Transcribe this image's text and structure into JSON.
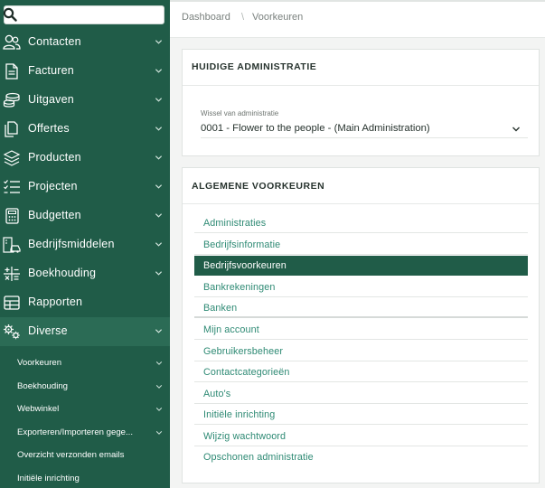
{
  "search": {
    "placeholder": ""
  },
  "sidebar": {
    "items": [
      {
        "label": "Contacten",
        "icon": "contacts-icon"
      },
      {
        "label": "Facturen",
        "icon": "invoice-icon"
      },
      {
        "label": "Uitgaven",
        "icon": "expenses-icon"
      },
      {
        "label": "Offertes",
        "icon": "quotes-icon"
      },
      {
        "label": "Producten",
        "icon": "products-icon"
      },
      {
        "label": "Projecten",
        "icon": "projects-icon"
      },
      {
        "label": "Budgetten",
        "icon": "budget-icon"
      },
      {
        "label": "Bedrijfsmiddelen",
        "icon": "assets-icon"
      },
      {
        "label": "Boekhouding",
        "icon": "accounting-icon"
      },
      {
        "label": "Rapporten",
        "icon": "reports-icon"
      },
      {
        "label": "Diverse",
        "icon": "gears-icon"
      }
    ],
    "subitems": [
      {
        "label": "Voorkeuren"
      },
      {
        "label": "Boekhouding"
      },
      {
        "label": "Webwinkel"
      },
      {
        "label": "Exporteren/Importeren gege..."
      },
      {
        "label": "Overzicht verzonden emails"
      },
      {
        "label": "Initiële inrichting"
      }
    ]
  },
  "breadcrumb": {
    "home": "Dashboard",
    "separator": "\\",
    "current": "Voorkeuren"
  },
  "admin_card": {
    "title": "HUIDIGE ADMINISTRATIE",
    "field_label": "Wissel van administratie",
    "field_value": "0001 - Flower to the people - (Main Administration)"
  },
  "prefs_card": {
    "title": "ALGEMENE VOORKEUREN",
    "items": [
      {
        "label": "Administraties"
      },
      {
        "label": "Bedrijfsinformatie"
      },
      {
        "label": "Bedrijfsvoorkeuren"
      },
      {
        "label": "Bankrekeningen"
      },
      {
        "label": "Banken"
      },
      {
        "label": "Mijn account"
      },
      {
        "label": "Gebruikersbeheer"
      },
      {
        "label": "Contactcategorieën"
      },
      {
        "label": "Auto's"
      },
      {
        "label": "Initiële inrichting"
      },
      {
        "label": "Wijzig wachtwoord"
      },
      {
        "label": "Opschonen administratie"
      }
    ],
    "selected": "Bedrijfsvoorkeuren"
  },
  "colors": {
    "sidebar_bg": "#205c48",
    "accent": "#2e8a74",
    "active_item": "#2b6b55"
  }
}
